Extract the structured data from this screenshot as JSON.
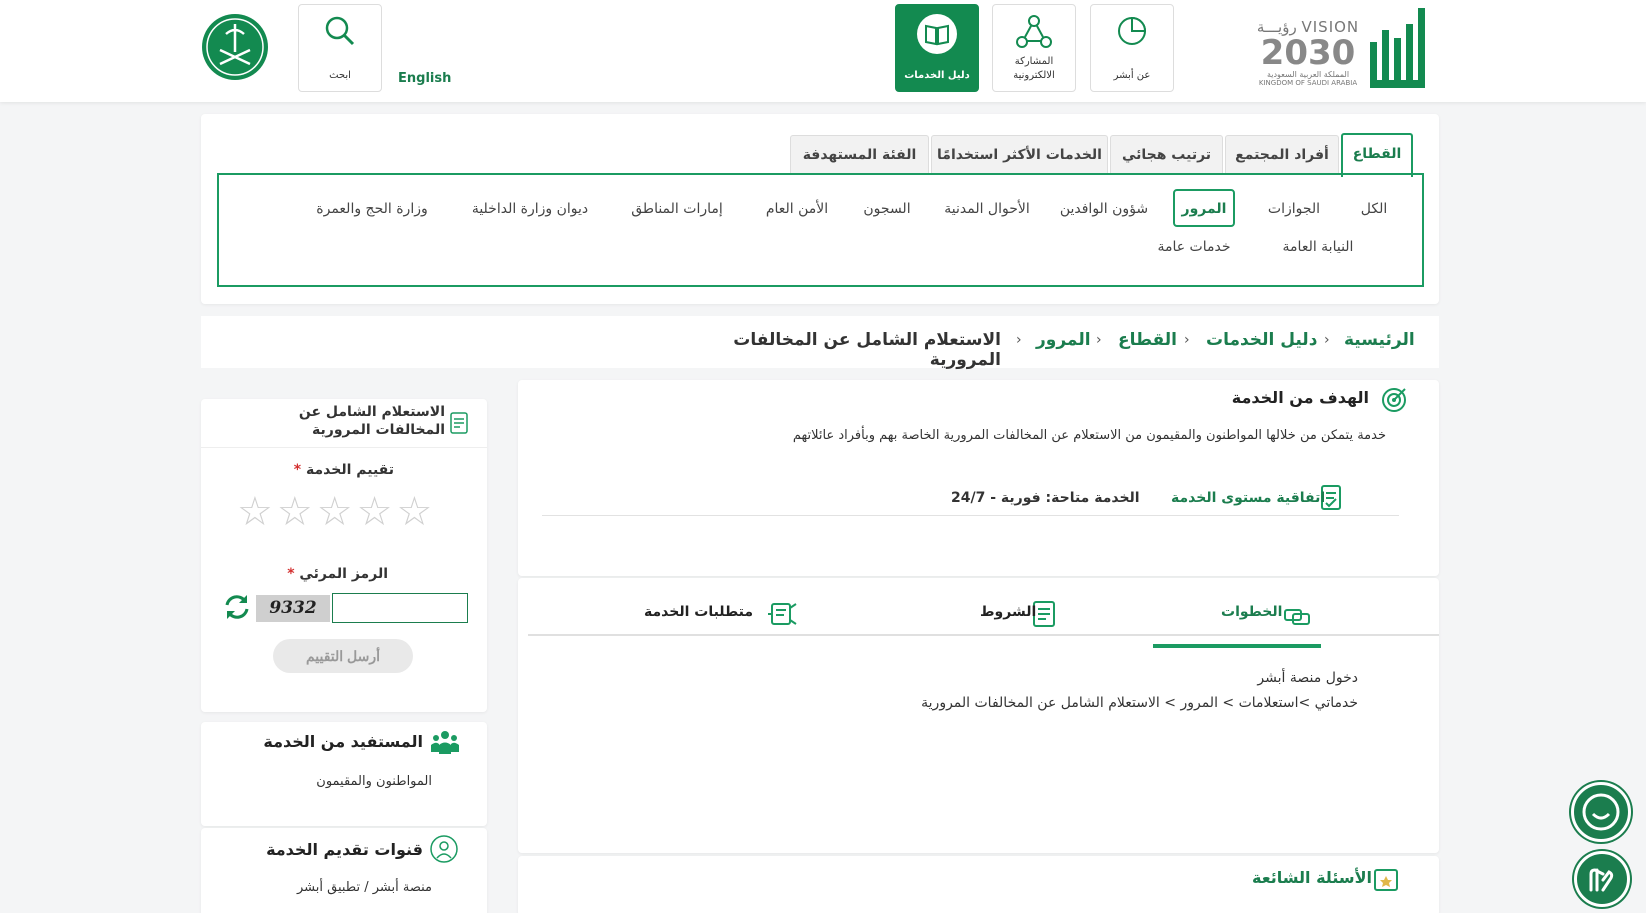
{
  "header": {
    "logo_absher": "أبشر",
    "logo_vision_title": "رؤيـــة VISION",
    "logo_vision_year": "2030",
    "logo_vision_sub_ar": "المملكة العربية السعودية",
    "logo_vision_sub_en": "KINGDOM OF SAUDI ARABIA",
    "about_label": "عن أبشر",
    "participation_label": "المشاركة الالكترونية",
    "services_guide_label": "دليل الخدمات",
    "english_label": "English",
    "search_label": "ابحث"
  },
  "tabs": [
    {
      "label": "القطاع",
      "active": true
    },
    {
      "label": "أفراد المجتمع"
    },
    {
      "label": "ترتيب هجائي"
    },
    {
      "label": "الخدمات الأكثر استخدامًا"
    },
    {
      "label": "الفئة المستهدفة"
    }
  ],
  "sectors": {
    "row1": [
      "الكل",
      "الجوازات",
      "المرور",
      "شؤون الوافدين",
      "الأحوال المدنية",
      "السجون",
      "الأمن العام",
      "إمارات المناطق",
      "ديوان وزارة الداخلية",
      "وزارة الحج والعمرة"
    ],
    "row2": [
      "النيابة العامة",
      "خدمات عامة"
    ],
    "active": "المرور"
  },
  "breadcrumb": {
    "home": "الرئيسية",
    "guide": "دليل الخدمات",
    "sector": "القطاع",
    "traffic": "المرور",
    "current": "الاستعلام الشامل عن المخالفات المرورية"
  },
  "goal": {
    "title": "الهدف من الخدمة",
    "description": "خدمة يتمكن من خلالها المواطنون والمقيمون من الاستعلام عن المخالفات المرورية الخاصة بهم وبأفراد عائلاتهم",
    "sla_label": "اتفاقية مستوى الخدمة",
    "sla_value": "الخدمة متاحة: فورية - 24/7"
  },
  "step_tabs": {
    "steps": "الخطوات",
    "conditions": "الشروط",
    "requirements": "متطلبات الخدمة"
  },
  "steps": {
    "line1": "دخول منصة أبشر",
    "line2": "خدماتي >استعلامات > المرور > الاستعلام الشامل عن المخالفات المرورية"
  },
  "faq": {
    "title": "الأسئلة الشائعة"
  },
  "rating": {
    "service_name": "الاستعلام الشامل عن المخالفات المرورية",
    "rating_label": "تقييم الخدمة",
    "required_mark": "*",
    "captcha_label": "الرمز المرئي",
    "captcha_text": "9332",
    "captcha_value": "",
    "submit_label": "أرسل التقييم",
    "rating_value": 0,
    "rating_max": 5
  },
  "beneficiary": {
    "title": "المستفيد من الخدمة",
    "value": "المواطنون والمقيمون"
  },
  "channels": {
    "title": "قنوات تقديم الخدمة",
    "value": "منصة أبشر / تطبيق أبشر"
  },
  "colors": {
    "brand": "#1b7d4e",
    "accent": "#1b9b62"
  }
}
